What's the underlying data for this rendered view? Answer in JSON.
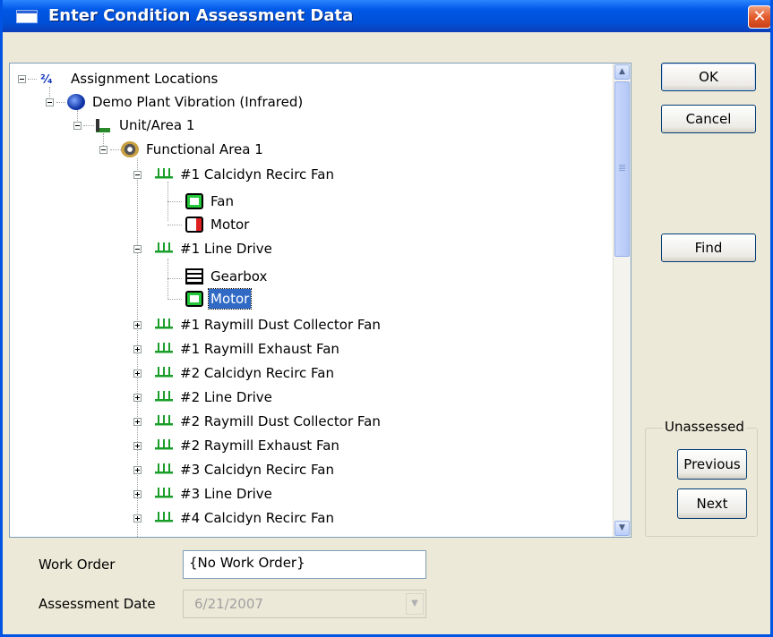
{
  "window": {
    "title": "Enter Condition Assessment Data",
    "close_glyph": "✕"
  },
  "buttons": {
    "ok": "OK",
    "cancel": "Cancel",
    "find": "Find",
    "previous": "Previous",
    "next": "Next"
  },
  "unassessed_group": {
    "label": "Unassessed"
  },
  "tree": {
    "items": [
      {
        "label": "Assignment Locations",
        "icon": "assignment-icon",
        "expanded": true
      },
      {
        "label": "Demo Plant Vibration (Infrared)",
        "icon": "plant-icon",
        "expanded": true
      },
      {
        "label": "Unit/Area 1",
        "icon": "unit-area-icon",
        "expanded": true
      },
      {
        "label": "Functional Area 1",
        "icon": "gears-icon",
        "expanded": true
      },
      {
        "label": "#1 Calcidyn Recirc Fan",
        "icon": "equipment-icon",
        "expanded": true
      },
      {
        "label": "Fan",
        "icon": "component-green-icon"
      },
      {
        "label": "Motor",
        "icon": "component-red-icon"
      },
      {
        "label": "#1 Line Drive",
        "icon": "equipment-icon",
        "expanded": true
      },
      {
        "label": "Gearbox",
        "icon": "gearbox-icon"
      },
      {
        "label": "Motor",
        "icon": "component-green-icon",
        "selected": true
      },
      {
        "label": "#1 Raymill Dust Collector Fan",
        "icon": "equipment-icon",
        "expanded": false
      },
      {
        "label": "#1 Raymill Exhaust Fan",
        "icon": "equipment-icon",
        "expanded": false
      },
      {
        "label": "#2 Calcidyn Recirc Fan",
        "icon": "equipment-icon",
        "expanded": false
      },
      {
        "label": "#2 Line Drive",
        "icon": "equipment-icon",
        "expanded": false
      },
      {
        "label": "#2 Raymill Dust Collector Fan",
        "icon": "equipment-icon",
        "expanded": false
      },
      {
        "label": "#2 Raymill Exhaust Fan",
        "icon": "equipment-icon",
        "expanded": false
      },
      {
        "label": "#3 Calcidyn Recirc Fan",
        "icon": "equipment-icon",
        "expanded": false
      },
      {
        "label": "#3 Line Drive",
        "icon": "equipment-icon",
        "expanded": false
      },
      {
        "label": "#4 Calcidyn Recirc Fan",
        "icon": "equipment-icon",
        "expanded": false
      }
    ]
  },
  "form": {
    "work_order_label": "Work Order",
    "work_order_value": "{No Work Order}",
    "assessment_date_label": "Assessment Date",
    "assessment_date_value": "6/21/2007"
  },
  "colors": {
    "titlebar": "#0058e6",
    "selection": "#316ac5",
    "status_green": "#22c83a",
    "status_red": "#e02020",
    "equipment_green": "#1a9e2a"
  }
}
